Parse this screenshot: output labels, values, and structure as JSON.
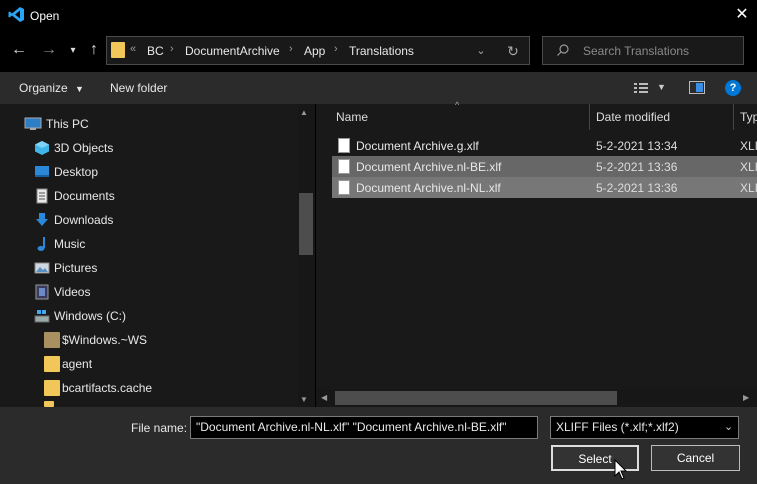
{
  "window": {
    "title": "Open"
  },
  "address": {
    "overflow": "«",
    "crumbs": [
      "BC",
      "DocumentArchive",
      "App",
      "Translations"
    ]
  },
  "search": {
    "placeholder": "Search Translations"
  },
  "toolbar": {
    "organize": "Organize",
    "new_folder": "New folder"
  },
  "nav_tree": [
    {
      "label": "This PC",
      "icon": "computer-icon"
    },
    {
      "label": "3D Objects",
      "icon": "cube-icon"
    },
    {
      "label": "Desktop",
      "icon": "desktop-icon"
    },
    {
      "label": "Documents",
      "icon": "documents-icon"
    },
    {
      "label": "Downloads",
      "icon": "download-arrow-icon"
    },
    {
      "label": "Music",
      "icon": "music-note-icon"
    },
    {
      "label": "Pictures",
      "icon": "pictures-icon"
    },
    {
      "label": "Videos",
      "icon": "film-icon"
    },
    {
      "label": "Windows (C:)",
      "icon": "drive-icon"
    },
    {
      "label": "$Windows.~WS",
      "icon": "folder-icon"
    },
    {
      "label": "agent",
      "icon": "folder-icon"
    },
    {
      "label": "bcartifacts.cache",
      "icon": "folder-icon"
    }
  ],
  "columns": {
    "name": "Name",
    "date": "Date modified",
    "type": "Typ"
  },
  "files": [
    {
      "name": "Document Archive.g.xlf",
      "date": "5-2-2021 13:34",
      "type": "XLI",
      "selected": false
    },
    {
      "name": "Document Archive.nl-BE.xlf",
      "date": "5-2-2021 13:36",
      "type": "XLI",
      "selected": true
    },
    {
      "name": "Document Archive.nl-NL.xlf",
      "date": "5-2-2021 13:36",
      "type": "XLI",
      "selected": true
    }
  ],
  "bottom": {
    "filename_label": "File name:",
    "filename_value": "\"Document Archive.nl-NL.xlf\" \"Document Archive.nl-BE.xlf\"",
    "filter_value": "XLIFF Files (*.xlf;*.xlf2)",
    "select_label": "Select",
    "cancel_label": "Cancel"
  },
  "colors": {
    "accent": "#0078d7",
    "folder": "#f2c75a",
    "selection": "#777777"
  }
}
